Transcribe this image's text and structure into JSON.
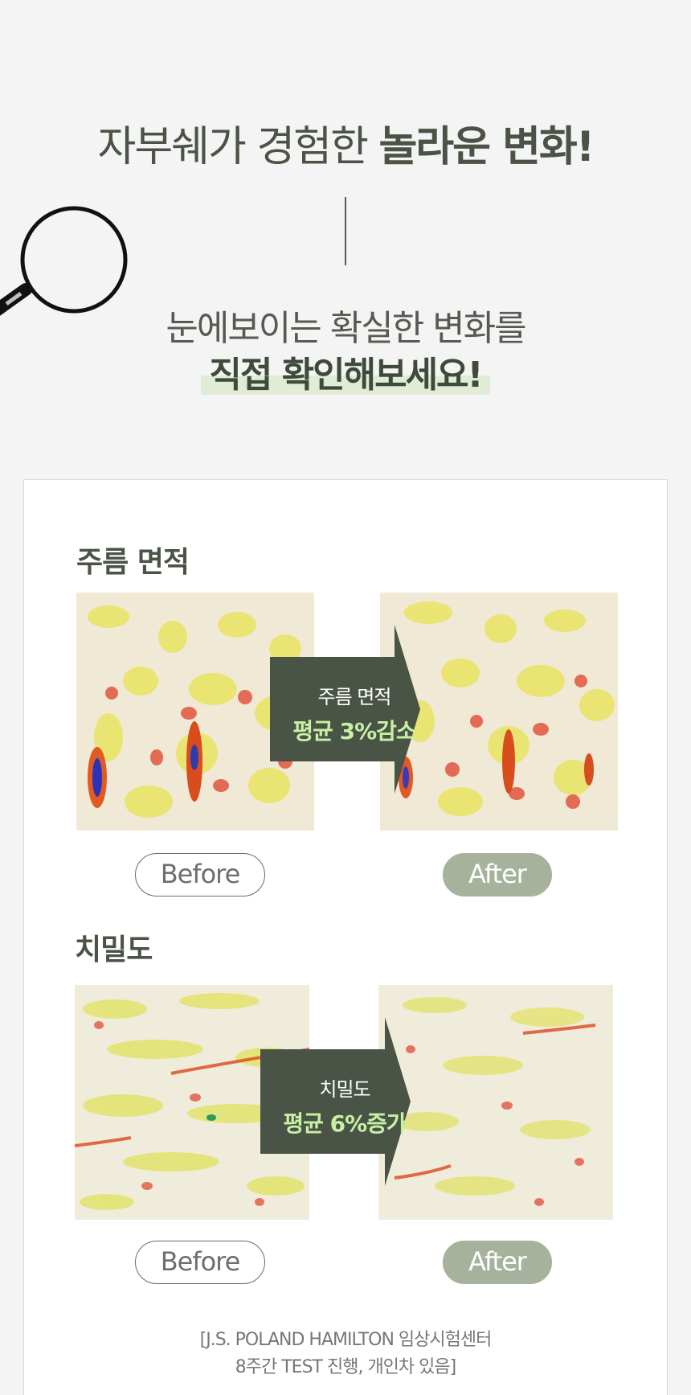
{
  "headline": {
    "light": "자부쉐가 경험한 ",
    "bold": "놀라운 변화!"
  },
  "subheading": {
    "line1": "눈에보이는 확실한 변화를",
    "line2": "직접 확인해보세요!"
  },
  "sections": [
    {
      "title": "주름 면적",
      "arrow_label": "주름 면적",
      "arrow_value": "평균 3%감소",
      "before_label": "Before",
      "after_label": "After"
    },
    {
      "title": "치밀도",
      "arrow_label": "치밀도",
      "arrow_value": "평균 6%증가",
      "before_label": "Before",
      "after_label": "After"
    }
  ],
  "footnote": {
    "line1": "[J.S. POLAND HAMILTON 임상시험센터",
    "line2": "8주간 TEST 진행, 개인차 있음]"
  },
  "colors": {
    "accent_dark": "#4a5446",
    "accent_green_text": "#c8f0a4",
    "pill_after": "#a7b29d",
    "highlight": "#e1ecd6"
  }
}
